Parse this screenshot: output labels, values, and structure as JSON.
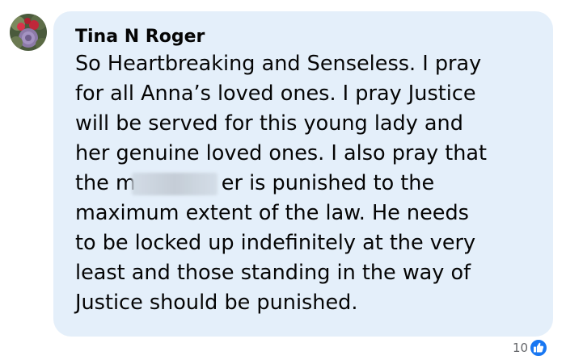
{
  "comment": {
    "author": "Tina N Roger",
    "avatar_icon": "profile-photo-flowers",
    "lines": [
      "So Heartbreaking and Senseless. I pray",
      "for all Anna’s loved ones. I pray Justice",
      "will be served for this young lady and",
      "her genuine loved ones. I also pray that",
      "the m",
      "er is punished to the",
      "maximum extent of the law. He needs",
      "to be locked up indefinitely at the very",
      "least and those standing in the way of",
      "Justice should be punished."
    ],
    "bubble_color": "#e4effa",
    "text_color": "#050505"
  },
  "reactions": {
    "count": "10",
    "icon": "like-thumb-icon",
    "accent": "#1877f2"
  }
}
